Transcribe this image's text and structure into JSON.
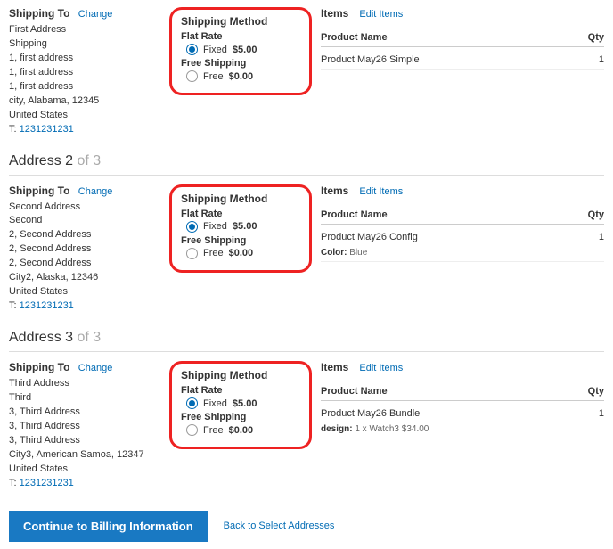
{
  "labels": {
    "shipping_to": "Shipping To",
    "change": "Change",
    "shipping_method": "Shipping Method",
    "items": "Items",
    "edit_items": "Edit Items",
    "product_name": "Product Name",
    "qty": "Qty",
    "continue": "Continue to Billing Information",
    "back": "Back to Select Addresses",
    "tel_prefix": "T: "
  },
  "rates": {
    "flat_label": "Flat Rate",
    "flat_option_text": "Fixed ",
    "flat_price": "$5.00",
    "free_label": "Free Shipping",
    "free_option_text": "Free ",
    "free_price": "$0.00"
  },
  "blocks": [
    {
      "heading_num": "",
      "heading_of": "",
      "addr_lines": [
        "First Address",
        "Shipping",
        "1, first address",
        "1, first address",
        "1, first address",
        "city, Alabama, 12345",
        "United States"
      ],
      "phone": "1231231231",
      "product": "Product May26 Simple",
      "qty": "1",
      "attr_key": "",
      "attr_val": ""
    },
    {
      "heading_num": "Address 2 ",
      "heading_of": "of 3",
      "addr_lines": [
        "Second Address",
        "Second",
        "2, Second Address",
        "2, Second Address",
        "2, Second Address",
        "City2, Alaska, 12346",
        "United States"
      ],
      "phone": "1231231231",
      "product": "Product May26 Config",
      "qty": "1",
      "attr_key": "Color:",
      "attr_val": "Blue"
    },
    {
      "heading_num": "Address 3 ",
      "heading_of": "of 3",
      "addr_lines": [
        "Third Address",
        "Third",
        "3, Third Address",
        "3, Third Address",
        "3, Third Address",
        "City3, American Samoa, 12347",
        "United States"
      ],
      "phone": "1231231231",
      "product": "Product May26 Bundle",
      "qty": "1",
      "attr_key": "design:",
      "attr_val": "1 x Watch3 $34.00"
    }
  ]
}
